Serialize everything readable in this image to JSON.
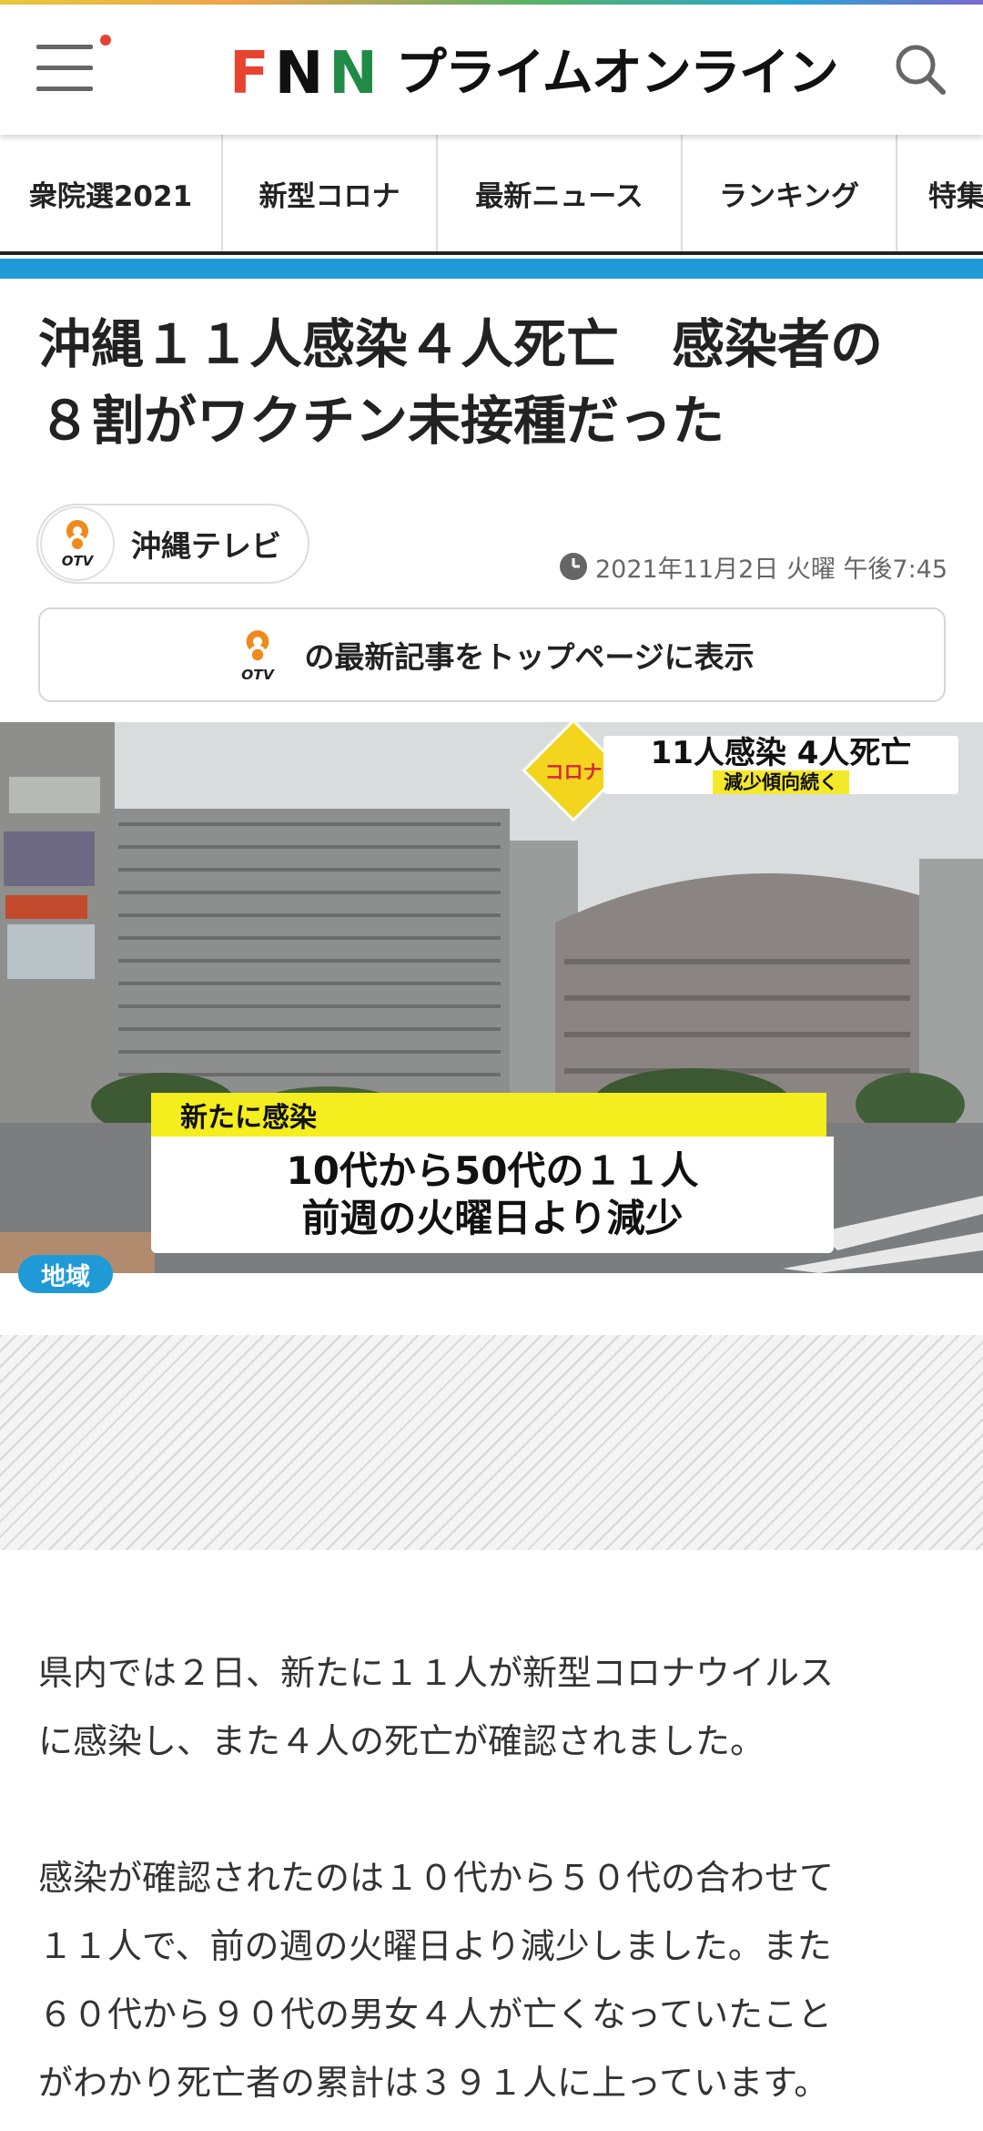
{
  "header": {
    "logo_brand": "FNN",
    "logo_sub": "プライムオンライン"
  },
  "nav": {
    "items": [
      {
        "label": "衆院選2021"
      },
      {
        "label": "新型コロナ"
      },
      {
        "label": "最新ニュース"
      },
      {
        "label": "ランキング"
      },
      {
        "label": "特集"
      }
    ]
  },
  "article": {
    "headline_line1": "沖縄１１人感染４人死亡　感染者の",
    "headline_line2": "８割がワクチン未接種だった",
    "source_name": "沖縄テレビ",
    "source_logo_text": "OTV",
    "timestamp": "2021年11月2日 火曜 午後7:45",
    "show_latest_label": "の最新記事をトップページに表示",
    "photo": {
      "badge": "コロナ",
      "headline_main": "11人感染 4人死亡",
      "headline_sub": "減少傾向続く",
      "ticker_title": "新たに感染",
      "ticker_line1": "10代から50代の１１人",
      "ticker_line2": "前週の火曜日より減少",
      "category_badge": "地域"
    },
    "paragraphs": [
      {
        "l1": "県内では２日、新たに１１人が新型コロナウイルス",
        "l2": "に感染し、また４人の死亡が確認されました。"
      },
      {
        "l1": "感染が確認されたのは１０代から５０代の合わせて",
        "l2": "１１人で、前の週の火曜日より減少しました。また",
        "l3": "６０代から９０代の男女４人が亡くなっていたこと",
        "l4": "がわかり死亡者の累計は３９１人に上っています。"
      }
    ]
  },
  "colors": {
    "accent_blue": "#1f9ad6",
    "ticker_yellow": "#f4ee1e",
    "logo_red": "#e8432f",
    "logo_green": "#1f8b45"
  }
}
